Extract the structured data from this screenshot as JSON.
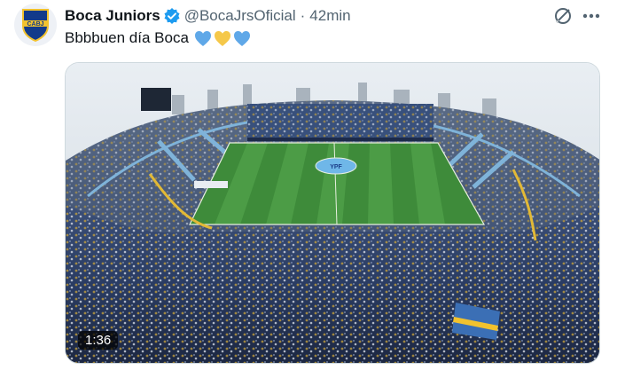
{
  "tweet": {
    "author_name": "Boca Juniors",
    "handle": "@BocaJrsOficial",
    "separator": "·",
    "time": "42min",
    "text": "Bbbbuen día Boca",
    "hearts": [
      "blue",
      "yellow",
      "blue"
    ],
    "avatar_label": "CABJ",
    "video_duration": "1:36",
    "field_logo": "YPF"
  },
  "icons": {
    "verified": "verified-badge-icon",
    "grok": "grok-icon",
    "more": "more-options-icon"
  },
  "colors": {
    "verified": "#1d9bf0",
    "heart_blue": "#5fa8e8",
    "heart_yellow": "#f5c84a",
    "club_blue": "#123a8a",
    "club_gold": "#f2c22e"
  }
}
